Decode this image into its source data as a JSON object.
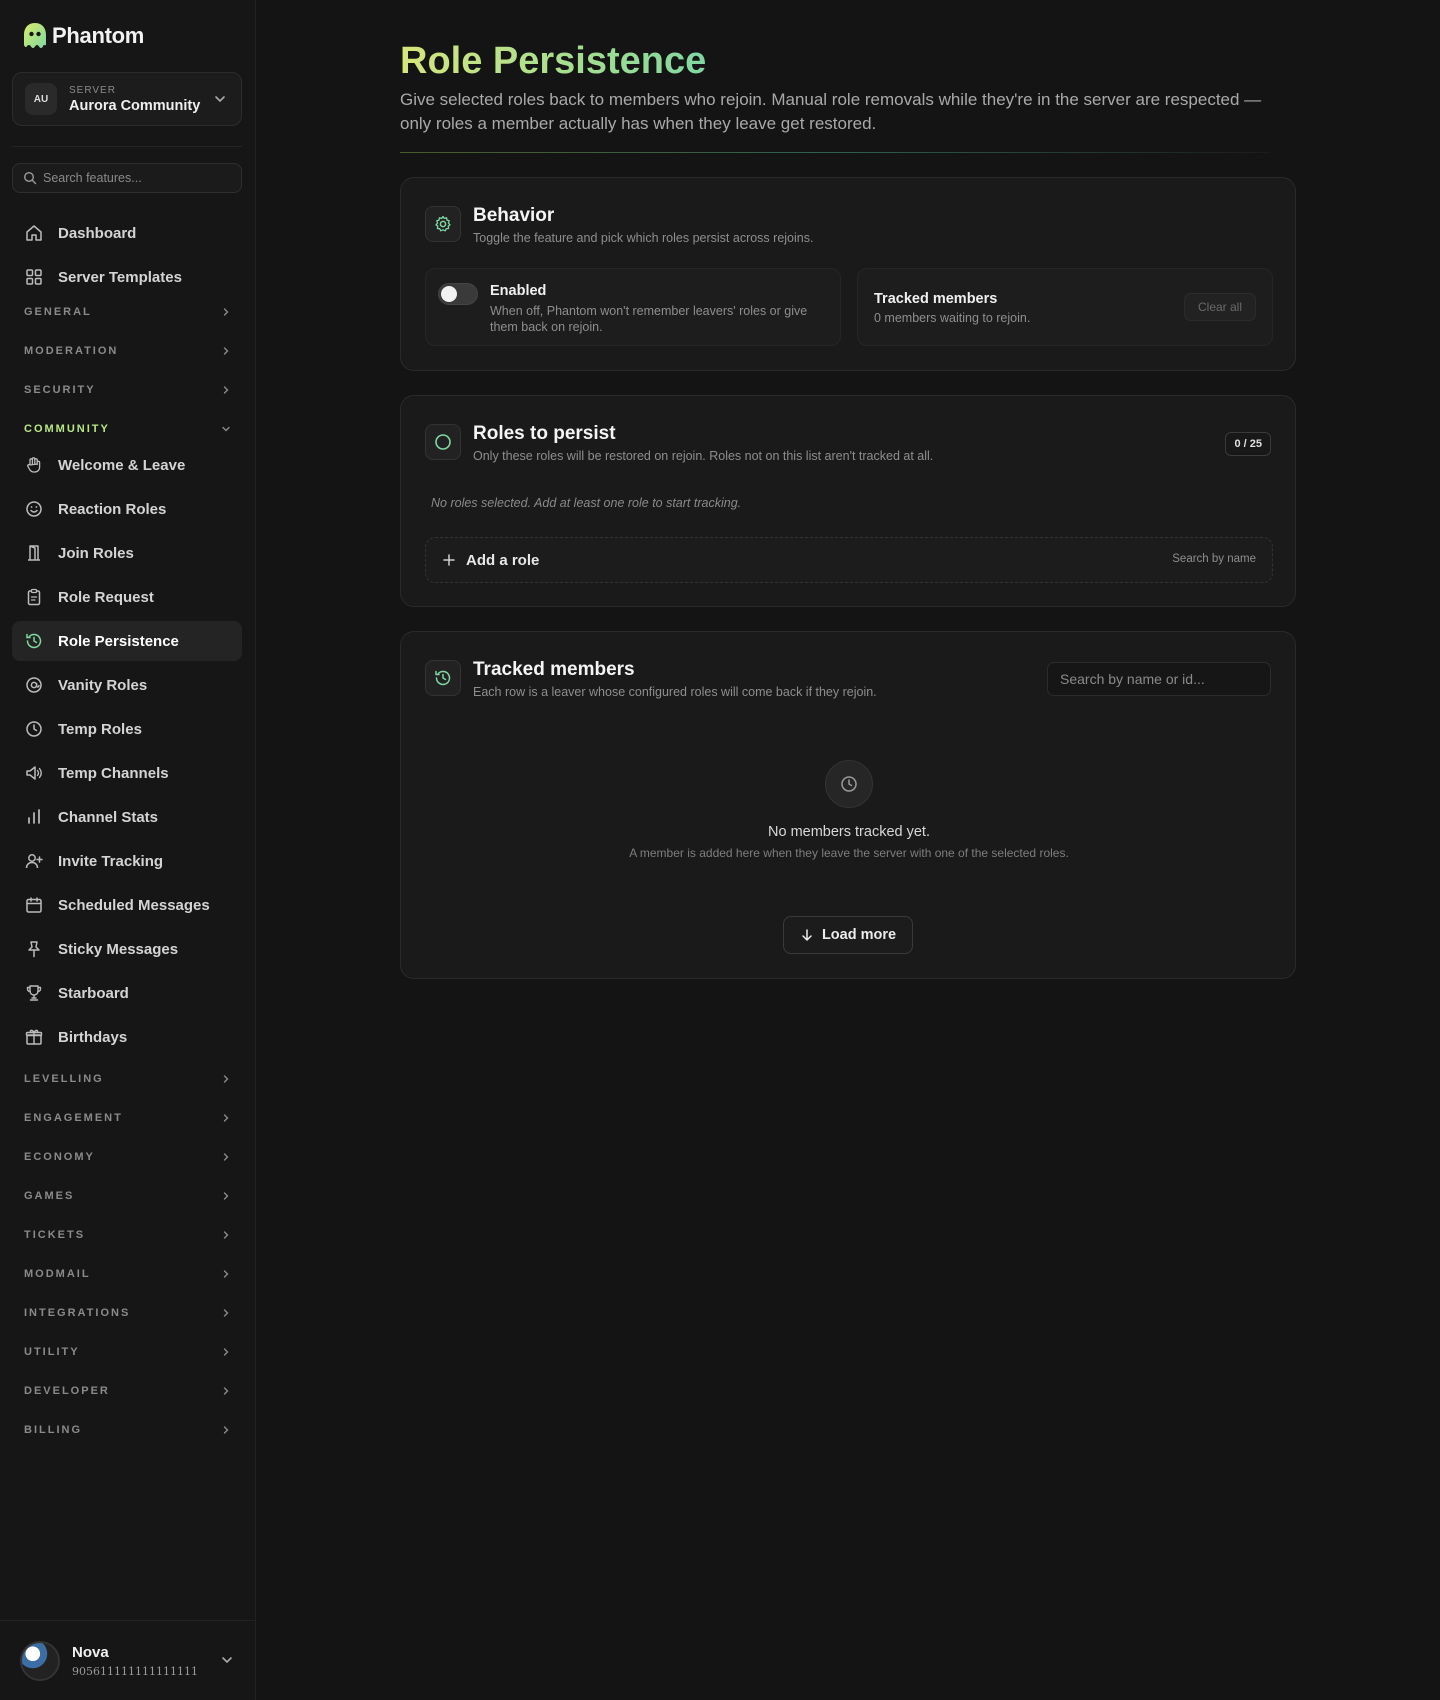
{
  "brand": {
    "name": "Phantom"
  },
  "server": {
    "kicker": "SERVER",
    "avatar": "AU",
    "name": "Aurora Community"
  },
  "sidebar": {
    "search_placeholder": "Search features...",
    "top_items": [
      {
        "label": "Dashboard",
        "icon": "home-icon"
      },
      {
        "label": "Server Templates",
        "icon": "grid-icon"
      }
    ],
    "sections_before": [
      "GENERAL",
      "MODERATION",
      "SECURITY"
    ],
    "open_section": "COMMUNITY",
    "community_items": [
      {
        "label": "Welcome & Leave",
        "icon": "hand-icon"
      },
      {
        "label": "Reaction Roles",
        "icon": "smile-icon"
      },
      {
        "label": "Join Roles",
        "icon": "door-icon"
      },
      {
        "label": "Role Request",
        "icon": "clipboard-icon"
      },
      {
        "label": "Role Persistence",
        "icon": "history-icon",
        "active": true
      },
      {
        "label": "Vanity Roles",
        "icon": "at-icon"
      },
      {
        "label": "Temp Roles",
        "icon": "clock-icon"
      },
      {
        "label": "Temp Channels",
        "icon": "speaker-icon"
      },
      {
        "label": "Channel Stats",
        "icon": "bar-chart-icon"
      },
      {
        "label": "Invite Tracking",
        "icon": "user-plus-icon"
      },
      {
        "label": "Scheduled Messages",
        "icon": "calendar-icon"
      },
      {
        "label": "Sticky Messages",
        "icon": "pin-icon"
      },
      {
        "label": "Starboard",
        "icon": "trophy-icon"
      },
      {
        "label": "Birthdays",
        "icon": "gift-icon"
      }
    ],
    "sections_after": [
      "LEVELLING",
      "ENGAGEMENT",
      "ECONOMY",
      "GAMES",
      "TICKETS",
      "MODMAIL",
      "INTEGRATIONS",
      "UTILITY",
      "DEVELOPER",
      "BILLING"
    ]
  },
  "user": {
    "name": "Nova",
    "id": "905611111111111111"
  },
  "page": {
    "title": "Role Persistence",
    "description": "Give selected roles back to members who rejoin. Manual role removals while they're in the server are respected — only roles a member actually has when they leave get restored."
  },
  "behavior": {
    "title": "Behavior",
    "subtitle": "Toggle the feature and pick which roles persist across rejoins.",
    "enabled_label": "Enabled",
    "enabled_desc": "When off, Phantom won't remember leavers' roles or give them back on rejoin.",
    "enabled": false,
    "tracked_title": "Tracked members",
    "tracked_desc": "0 members waiting to rejoin.",
    "clear_label": "Clear all"
  },
  "roles": {
    "title": "Roles to persist",
    "subtitle": "Only these roles will be restored on rejoin. Roles not on this list aren't tracked at all.",
    "count": "0 / 25",
    "empty_note": "No roles selected. Add at least one role to start tracking.",
    "add_label": "Add a role",
    "add_hint": "Search by name"
  },
  "tracked": {
    "title": "Tracked members",
    "subtitle": "Each row is a leaver whose configured roles will come back if they rejoin.",
    "search_placeholder": "Search by name or id...",
    "empty_title": "No members tracked yet.",
    "empty_sub": "A member is added here when they leave the server with one of the selected roles.",
    "load_more": "Load more"
  },
  "colors": {
    "accent": "#7fd8a0",
    "accent_lime": "#b8e986",
    "background": "#141414",
    "card": "#1a1a1a"
  }
}
